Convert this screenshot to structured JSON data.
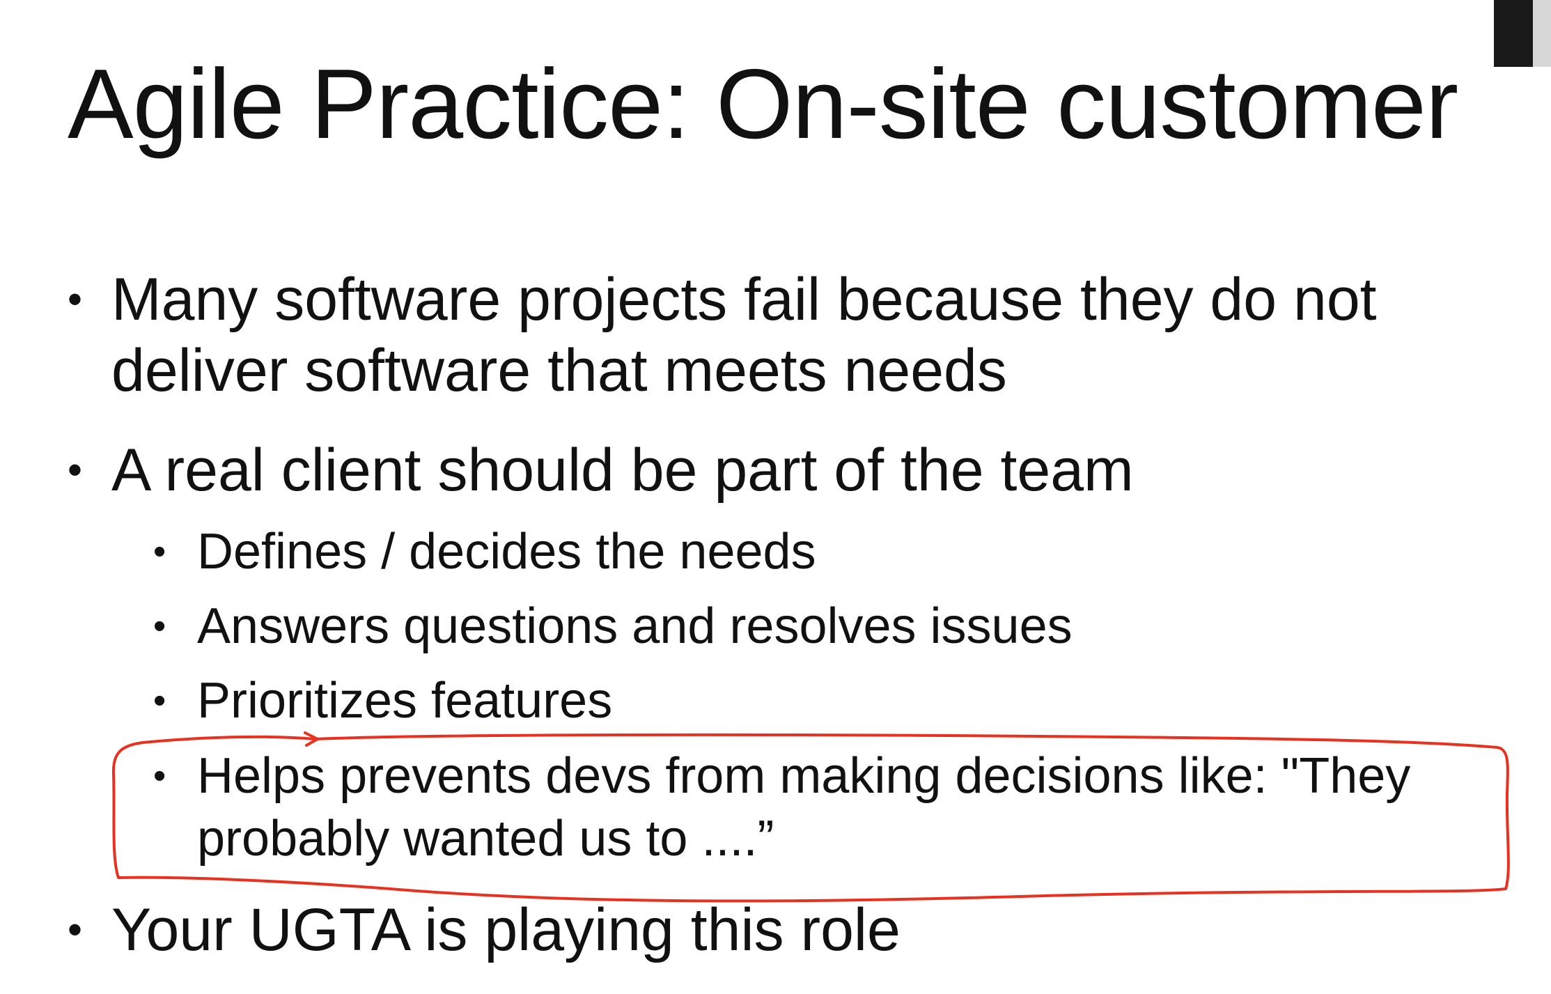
{
  "slide": {
    "title": "Agile Practice: On-site customer",
    "bullets": [
      {
        "line1": "Many software projects fail because they do not",
        "line2": "deliver software that meets needs"
      },
      {
        "text": "A real client should be part of the team"
      }
    ],
    "sub_bullets": [
      "Defines / decides the needs",
      "Answers questions and resolves issues",
      "Prioritizes features"
    ],
    "highlighted_sub_bullet": {
      "line1": "Helps prevents devs from making decisions like: \"They",
      "line2": "probably wanted us to ....”"
    },
    "last_bullet": "Your UGTA is playing this role",
    "bullet_glyph": "•"
  },
  "colors": {
    "annotation_ink": "#e8321f",
    "text": "#111111",
    "background": "#ffffff"
  }
}
